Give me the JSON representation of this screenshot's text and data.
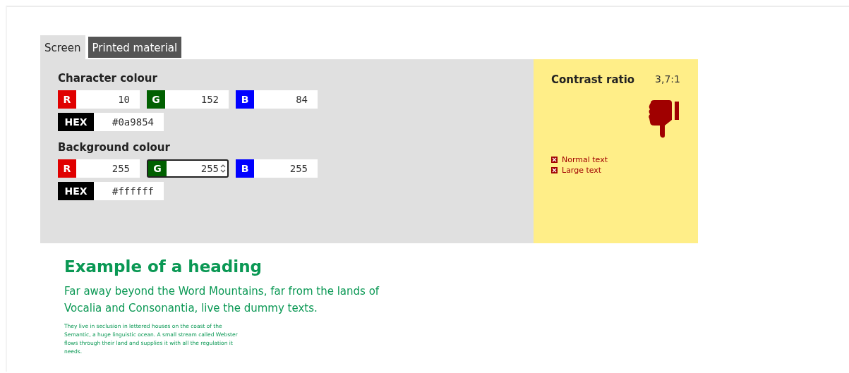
{
  "tabs": [
    {
      "label": "Screen",
      "selected": true
    },
    {
      "label": "Printed material",
      "selected": false
    }
  ],
  "colour_groups": [
    {
      "title": "Character colour",
      "channels": [
        {
          "label": "R",
          "color": "#e00000",
          "value": "10",
          "focused": false
        },
        {
          "label": "G",
          "color": "#006000",
          "value": "152",
          "focused": false
        },
        {
          "label": "B",
          "color": "#0000ff",
          "value": "84",
          "focused": false
        }
      ],
      "hex_label": "HEX",
      "hex": "#0a9854"
    },
    {
      "title": "Background colour",
      "channels": [
        {
          "label": "R",
          "color": "#e00000",
          "value": "255",
          "focused": false
        },
        {
          "label": "G",
          "color": "#006000",
          "value": "255",
          "focused": true
        },
        {
          "label": "B",
          "color": "#0000ff",
          "value": "255",
          "focused": false
        }
      ],
      "hex_label": "HEX",
      "hex": "#ffffff"
    }
  ],
  "result": {
    "label": "Contrast ratio",
    "ratio": "3,7:1",
    "passed": false,
    "checks": [
      {
        "label": "Normal text",
        "passed": false
      },
      {
        "label": "Large text",
        "passed": false
      }
    ]
  },
  "example": {
    "heading": "Example of a heading",
    "lead": "Far away beyond the Word Mountains, far from the lands of Vocalia and Consonantia, live the dummy texts.",
    "small": "They live in seclusion in lettered houses on the coast of the Semantic, a huge linguistic ocean. A small stream called Webster flows through their land and supplies it with all the regulation it needs."
  }
}
